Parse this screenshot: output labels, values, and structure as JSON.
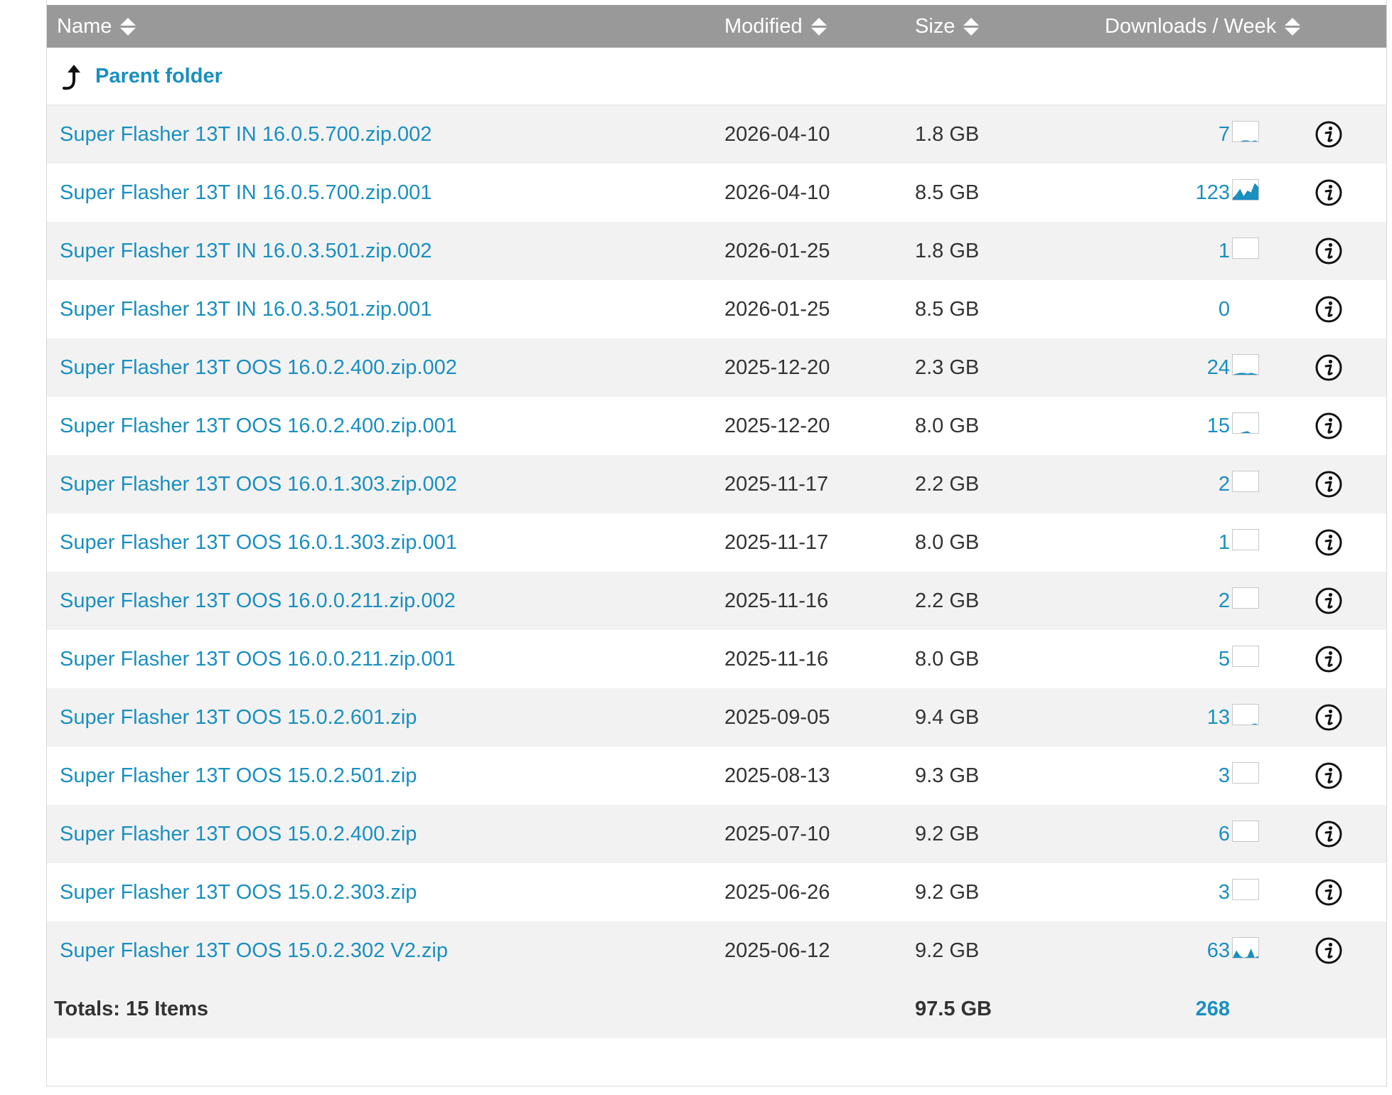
{
  "header": {
    "name": "Name",
    "modified": "Modified",
    "size": "Size",
    "downloads": "Downloads / Week"
  },
  "parent": {
    "label": "Parent folder"
  },
  "files": [
    {
      "name": "Super Flasher 13T IN 16.0.5.700.zip.002",
      "modified": "2026-04-10",
      "size": "1.8 GB",
      "downloads": "7",
      "spark": [
        0,
        0,
        0,
        0.05,
        0.05,
        0,
        0.05,
        0
      ]
    },
    {
      "name": "Super Flasher 13T IN 16.0.5.700.zip.001",
      "modified": "2026-04-10",
      "size": "8.5 GB",
      "downloads": "123",
      "spark": [
        0.1,
        0.3,
        0.6,
        0.2,
        0.5,
        0.4,
        0.9,
        0.7
      ]
    },
    {
      "name": "Super Flasher 13T IN 16.0.3.501.zip.002",
      "modified": "2026-01-25",
      "size": "1.8 GB",
      "downloads": "1",
      "spark": [
        0,
        0,
        0,
        0,
        0,
        0,
        0,
        0
      ]
    },
    {
      "name": "Super Flasher 13T IN 16.0.3.501.zip.001",
      "modified": "2026-01-25",
      "size": "8.5 GB",
      "downloads": "0",
      "spark": null
    },
    {
      "name": "Super Flasher 13T OOS 16.0.2.400.zip.002",
      "modified": "2025-12-20",
      "size": "2.3 GB",
      "downloads": "24",
      "spark": [
        0,
        0.05,
        0.1,
        0.1,
        0.05,
        0.1,
        0.05,
        0
      ]
    },
    {
      "name": "Super Flasher 13T OOS 16.0.2.400.zip.001",
      "modified": "2025-12-20",
      "size": "8.0 GB",
      "downloads": "15",
      "spark": [
        0,
        0,
        0,
        0.05,
        0.1,
        0,
        0,
        0
      ]
    },
    {
      "name": "Super Flasher 13T OOS 16.0.1.303.zip.002",
      "modified": "2025-11-17",
      "size": "2.2 GB",
      "downloads": "2",
      "spark": [
        0,
        0,
        0,
        0,
        0,
        0,
        0,
        0
      ]
    },
    {
      "name": "Super Flasher 13T OOS 16.0.1.303.zip.001",
      "modified": "2025-11-17",
      "size": "8.0 GB",
      "downloads": "1",
      "spark": [
        0,
        0,
        0,
        0,
        0,
        0,
        0,
        0
      ]
    },
    {
      "name": "Super Flasher 13T OOS 16.0.0.211.zip.002",
      "modified": "2025-11-16",
      "size": "2.2 GB",
      "downloads": "2",
      "spark": [
        0,
        0,
        0,
        0,
        0,
        0,
        0,
        0
      ]
    },
    {
      "name": "Super Flasher 13T OOS 16.0.0.211.zip.001",
      "modified": "2025-11-16",
      "size": "8.0 GB",
      "downloads": "5",
      "spark": [
        0,
        0,
        0,
        0,
        0,
        0,
        0,
        0
      ]
    },
    {
      "name": "Super Flasher 13T OOS 15.0.2.601.zip",
      "modified": "2025-09-05",
      "size": "9.4 GB",
      "downloads": "13",
      "spark": [
        0,
        0,
        0,
        0,
        0,
        0,
        0.05,
        0
      ]
    },
    {
      "name": "Super Flasher 13T OOS 15.0.2.501.zip",
      "modified": "2025-08-13",
      "size": "9.3 GB",
      "downloads": "3",
      "spark": [
        0,
        0,
        0,
        0,
        0,
        0,
        0,
        0
      ]
    },
    {
      "name": "Super Flasher 13T OOS 15.0.2.400.zip",
      "modified": "2025-07-10",
      "size": "9.2 GB",
      "downloads": "6",
      "spark": [
        0,
        0,
        0,
        0,
        0,
        0,
        0,
        0
      ]
    },
    {
      "name": "Super Flasher 13T OOS 15.0.2.303.zip",
      "modified": "2025-06-26",
      "size": "9.2 GB",
      "downloads": "3",
      "spark": [
        0,
        0,
        0,
        0,
        0,
        0,
        0,
        0
      ]
    },
    {
      "name": "Super Flasher 13T OOS 15.0.2.302 V2.zip",
      "modified": "2025-06-12",
      "size": "9.2 GB",
      "downloads": "63",
      "spark": [
        0,
        0.4,
        0.1,
        0,
        0.05,
        0.5,
        0,
        0.1
      ]
    }
  ],
  "totals": {
    "label": "Totals: 15 Items",
    "size": "97.5 GB",
    "downloads": "268"
  },
  "colors": {
    "link": "#1a8fc0",
    "header_bg": "#999999",
    "row_alt": "#f2f2f2",
    "spark": "#1a8fc0"
  },
  "icons": {
    "parent": "arrow-up-turn-icon",
    "sort": "sort-icon",
    "info": "info-icon"
  }
}
